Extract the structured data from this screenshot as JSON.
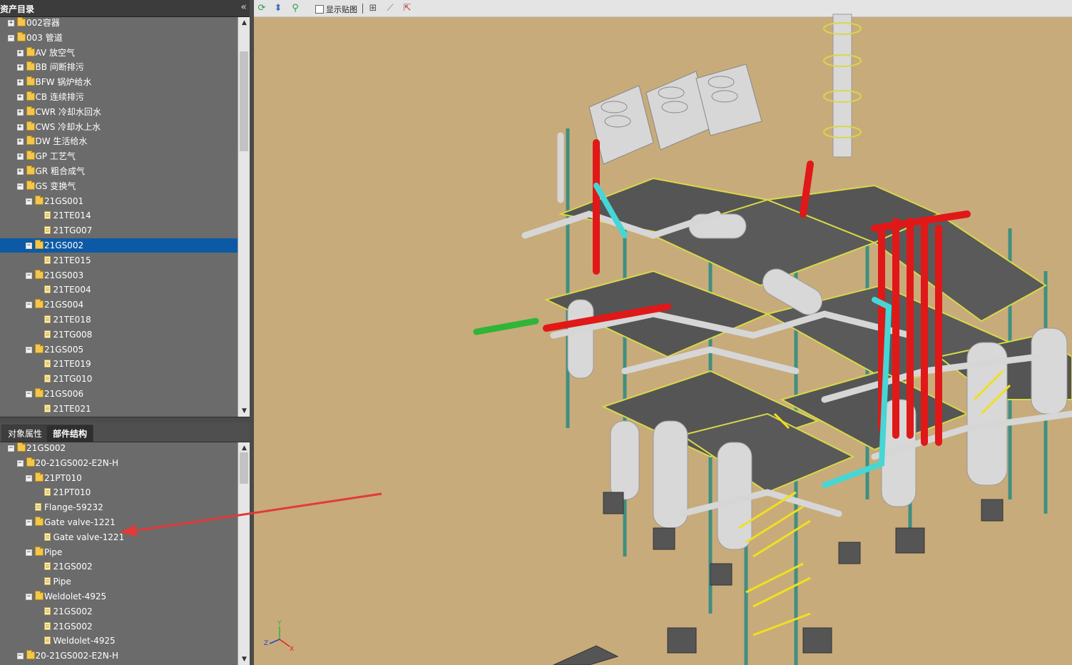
{
  "left_panel": {
    "title": "资产目录",
    "collapse_icon": "double-chevron-left-icon",
    "asset_tree": [
      {
        "label": "002容器",
        "indent": 0,
        "expander": "+",
        "icon": "folder"
      },
      {
        "label": "003 管道",
        "indent": 0,
        "expander": "-",
        "icon": "folder"
      },
      {
        "label": "AV 放空气",
        "indent": 1,
        "expander": "+",
        "icon": "folder"
      },
      {
        "label": "BB 间断排污",
        "indent": 1,
        "expander": "+",
        "icon": "folder"
      },
      {
        "label": "BFW 锅炉给水",
        "indent": 1,
        "expander": "+",
        "icon": "folder"
      },
      {
        "label": "CB 连续排污",
        "indent": 1,
        "expander": "+",
        "icon": "folder"
      },
      {
        "label": "CWR 冷却水回水",
        "indent": 1,
        "expander": "+",
        "icon": "folder"
      },
      {
        "label": "CWS 冷却水上水",
        "indent": 1,
        "expander": "+",
        "icon": "folder"
      },
      {
        "label": "DW 生活给水",
        "indent": 1,
        "expander": "+",
        "icon": "folder"
      },
      {
        "label": "GP 工艺气",
        "indent": 1,
        "expander": "+",
        "icon": "folder"
      },
      {
        "label": "GR 粗合成气",
        "indent": 1,
        "expander": "+",
        "icon": "folder"
      },
      {
        "label": "GS 变换气",
        "indent": 1,
        "expander": "-",
        "icon": "folder"
      },
      {
        "label": "21GS001",
        "indent": 2,
        "expander": "-",
        "icon": "folder"
      },
      {
        "label": "21TE014",
        "indent": 3,
        "expander": "",
        "icon": "doc"
      },
      {
        "label": "21TG007",
        "indent": 3,
        "expander": "",
        "icon": "doc"
      },
      {
        "label": "21GS002",
        "indent": 2,
        "expander": "-",
        "icon": "folder",
        "selected": true
      },
      {
        "label": "21TE015",
        "indent": 3,
        "expander": "",
        "icon": "doc"
      },
      {
        "label": "21GS003",
        "indent": 2,
        "expander": "-",
        "icon": "folder"
      },
      {
        "label": "21TE004",
        "indent": 3,
        "expander": "",
        "icon": "doc"
      },
      {
        "label": "21GS004",
        "indent": 2,
        "expander": "-",
        "icon": "folder"
      },
      {
        "label": "21TE018",
        "indent": 3,
        "expander": "",
        "icon": "doc"
      },
      {
        "label": "21TG008",
        "indent": 3,
        "expander": "",
        "icon": "doc"
      },
      {
        "label": "21GS005",
        "indent": 2,
        "expander": "-",
        "icon": "folder"
      },
      {
        "label": "21TE019",
        "indent": 3,
        "expander": "",
        "icon": "doc"
      },
      {
        "label": "21TG010",
        "indent": 3,
        "expander": "",
        "icon": "doc"
      },
      {
        "label": "21GS006",
        "indent": 2,
        "expander": "-",
        "icon": "folder"
      },
      {
        "label": "21TE021",
        "indent": 3,
        "expander": "",
        "icon": "doc"
      }
    ],
    "tabs": [
      {
        "label": "对象属性",
        "active": false
      },
      {
        "label": "部件结构",
        "active": true
      }
    ],
    "component_tree": [
      {
        "label": "21GS002",
        "indent": 0,
        "expander": "-",
        "icon": "folder"
      },
      {
        "label": "20-21GS002-E2N-H",
        "indent": 1,
        "expander": "-",
        "icon": "folder"
      },
      {
        "label": "21PT010",
        "indent": 2,
        "expander": "-",
        "icon": "folder"
      },
      {
        "label": "21PT010",
        "indent": 3,
        "expander": "",
        "icon": "doc"
      },
      {
        "label": "Flange-59232",
        "indent": 2,
        "expander": "",
        "icon": "doc"
      },
      {
        "label": "Gate valve-1221",
        "indent": 2,
        "expander": "-",
        "icon": "folder"
      },
      {
        "label": "Gate valve-1221",
        "indent": 3,
        "expander": "",
        "icon": "doc"
      },
      {
        "label": "Pipe",
        "indent": 2,
        "expander": "-",
        "icon": "folder"
      },
      {
        "label": "21GS002",
        "indent": 3,
        "expander": "",
        "icon": "doc"
      },
      {
        "label": "Pipe",
        "indent": 3,
        "expander": "",
        "icon": "doc"
      },
      {
        "label": "Weldolet-4925",
        "indent": 2,
        "expander": "-",
        "icon": "folder"
      },
      {
        "label": "21GS002",
        "indent": 3,
        "expander": "",
        "icon": "doc"
      },
      {
        "label": "21GS002",
        "indent": 3,
        "expander": "",
        "icon": "doc"
      },
      {
        "label": "Weldolet-4925",
        "indent": 3,
        "expander": "",
        "icon": "doc"
      },
      {
        "label": "20-21GS002-E2N-H",
        "indent": 1,
        "expander": "-",
        "icon": "folder"
      }
    ]
  },
  "toolbar": {
    "buttons": [
      {
        "name": "refresh-icon",
        "glyph": "⟳",
        "color": "#2e9c4a"
      },
      {
        "name": "fit-view-icon",
        "glyph": "⬍",
        "color": "#3a6fc4"
      },
      {
        "name": "zoom-icon",
        "glyph": "⚲",
        "color": "#2e9c4a"
      }
    ],
    "show_texture_label": "显示贴图",
    "show_texture_checked": false,
    "tools": [
      {
        "name": "section-box-icon",
        "glyph": "⊞"
      },
      {
        "name": "measure-icon",
        "glyph": "⟋"
      },
      {
        "name": "transform-icon",
        "glyph": "⇱"
      }
    ]
  },
  "viewport": {
    "background": "#c8ab7b",
    "axis_labels": {
      "y": "Y",
      "x": "X",
      "z": "Z"
    },
    "annotation_arrow_color": "#e23a3a"
  }
}
